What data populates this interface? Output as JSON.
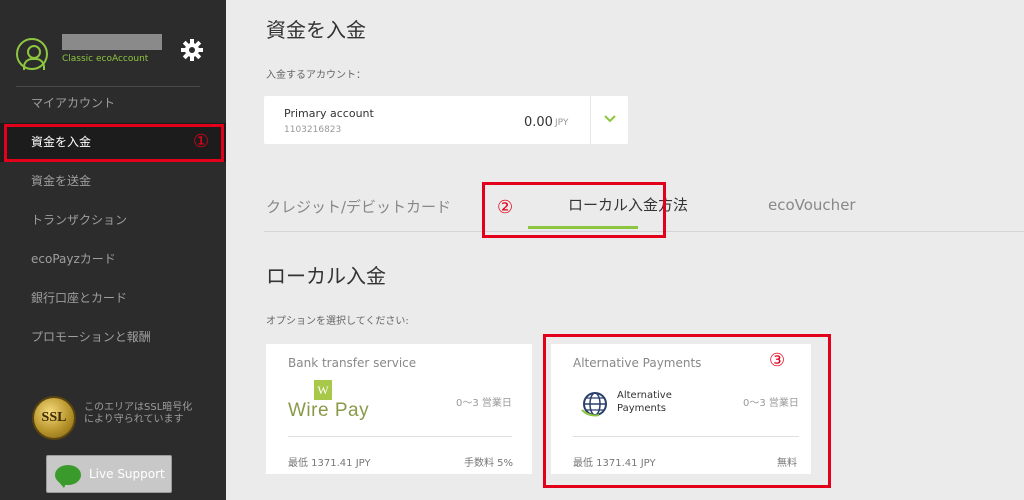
{
  "sidebar": {
    "account_type": "Classic ecoAccount",
    "items": [
      {
        "label": "マイアカウント"
      },
      {
        "label": "資金を入金"
      },
      {
        "label": "資金を送金"
      },
      {
        "label": "トランザクション"
      },
      {
        "label": "ecoPayzカード"
      },
      {
        "label": "銀行口座とカード"
      },
      {
        "label": "プロモーションと報酬"
      }
    ],
    "ssl_badge": "SSL",
    "ssl_text": "このエリアはSSL暗号化により守られています",
    "support_label": "Live Support"
  },
  "annotations": {
    "one": "①",
    "two": "②",
    "three": "③"
  },
  "main": {
    "title": "資金を入金",
    "account_label": "入金するアカウント：",
    "account": {
      "name": "Primary account",
      "number": "1103216823",
      "amount": "0.00",
      "currency": "JPY"
    },
    "tabs": [
      {
        "label": "クレジット/デビットカード"
      },
      {
        "label": "ローカル入金方法"
      },
      {
        "label": "ecoVoucher"
      }
    ],
    "section_title": "ローカル入金",
    "options_label": "オプションを選択してください:",
    "cards": [
      {
        "title": "Bank transfer service",
        "logo_mark": "W",
        "logo_text": "Wire Pay",
        "days": "0〜3 営業日",
        "min": "最低 1371.41 JPY",
        "fee": "手数料 5%"
      },
      {
        "title": "Alternative Payments",
        "logo_text": "Alternative Payments",
        "days": "0〜3 営業日",
        "min": "最低 1371.41 JPY",
        "fee": "無料"
      }
    ]
  },
  "colors": {
    "accent": "#8dc63f",
    "annotation": "#e3001b",
    "sidebar": "#2c2c2c"
  }
}
